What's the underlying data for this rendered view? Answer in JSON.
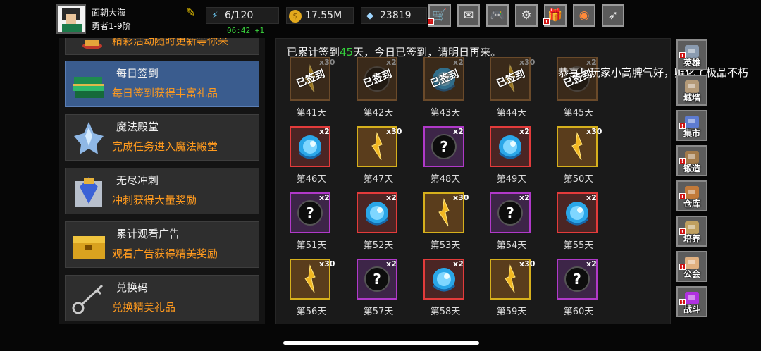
{
  "player": {
    "name": "面朝大海",
    "rank": "勇者1-9阶"
  },
  "resources": {
    "energy": "6/120",
    "timer": "06:42 +1",
    "gold": "17.55M",
    "gems": "23819"
  },
  "toolbar": [
    {
      "name": "shop-cart-icon",
      "badge": "!"
    },
    {
      "name": "mail-icon",
      "badge": ""
    },
    {
      "name": "gamepad-icon",
      "badge": ""
    },
    {
      "name": "gear-icon",
      "badge": ""
    },
    {
      "name": "gift-icon",
      "badge": "!"
    },
    {
      "name": "color-wheel-icon",
      "badge": ""
    },
    {
      "name": "feather-icon",
      "badge": ""
    }
  ],
  "menu": {
    "partial_desc": "精彩活动随时更新等你来",
    "items": [
      {
        "title": "每日签到",
        "desc": "每日签到获得丰富礼品",
        "selected": true
      },
      {
        "title": "魔法殿堂",
        "desc": "完成任务进入魔法殿堂",
        "selected": false
      },
      {
        "title": "无尽冲刺",
        "desc": "冲刺获得大量奖励",
        "selected": false
      },
      {
        "title": "累计观看广告",
        "desc": "观看广告获得精美奖励",
        "selected": false
      },
      {
        "title": "兑换码",
        "desc": "兑换精美礼品",
        "selected": false
      }
    ]
  },
  "checkin": {
    "notice_prefix": "已累计签到",
    "days_count": "45",
    "notice_suffix": "天，今日已签到，请明日再来。",
    "signed_stamp": "已签到",
    "rows": [
      [
        {
          "day": "第41天",
          "qty": "x30",
          "item": "gold-crystal",
          "signed": true
        },
        {
          "day": "第42天",
          "qty": "x2",
          "item": "mystery-orb",
          "signed": true
        },
        {
          "day": "第43天",
          "qty": "x2",
          "item": "blue-orb",
          "signed": true
        },
        {
          "day": "第44天",
          "qty": "x30",
          "item": "gold-crystal",
          "signed": true
        },
        {
          "day": "第45天",
          "qty": "x2",
          "item": "mystery-orb",
          "signed": true
        }
      ],
      [
        {
          "day": "第46天",
          "qty": "x2",
          "item": "blue-orb",
          "signed": false
        },
        {
          "day": "第47天",
          "qty": "x30",
          "item": "gold-crystal",
          "signed": false
        },
        {
          "day": "第48天",
          "qty": "x2",
          "item": "mystery-orb",
          "signed": false
        },
        {
          "day": "第49天",
          "qty": "x2",
          "item": "blue-orb",
          "signed": false
        },
        {
          "day": "第50天",
          "qty": "x30",
          "item": "gold-crystal",
          "signed": false
        }
      ],
      [
        {
          "day": "第51天",
          "qty": "x2",
          "item": "mystery-orb",
          "signed": false
        },
        {
          "day": "第52天",
          "qty": "x2",
          "item": "blue-orb",
          "signed": false
        },
        {
          "day": "第53天",
          "qty": "x30",
          "item": "gold-crystal",
          "signed": false
        },
        {
          "day": "第54天",
          "qty": "x2",
          "item": "mystery-orb",
          "signed": false
        },
        {
          "day": "第55天",
          "qty": "x2",
          "item": "blue-orb",
          "signed": false
        }
      ],
      [
        {
          "day": "第56天",
          "qty": "x30",
          "item": "gold-crystal",
          "signed": false
        },
        {
          "day": "第57天",
          "qty": "x2",
          "item": "mystery-orb",
          "signed": false
        },
        {
          "day": "第58天",
          "qty": "x2",
          "item": "blue-orb",
          "signed": false
        },
        {
          "day": "第59天",
          "qty": "x30",
          "item": "gold-crystal",
          "signed": false
        },
        {
          "day": "第60天",
          "qty": "x2",
          "item": "mystery-orb",
          "signed": false
        }
      ]
    ]
  },
  "ticker": "恭喜！玩家小高脾气好，孵化了极品不朽",
  "sidenav": [
    {
      "label": "英雄",
      "badge": "!"
    },
    {
      "label": "城墙",
      "badge": ""
    },
    {
      "label": "集市",
      "badge": "!"
    },
    {
      "label": "锻造",
      "badge": "!"
    },
    {
      "label": "仓库",
      "badge": "!"
    },
    {
      "label": "培养",
      "badge": "!"
    },
    {
      "label": "公会",
      "badge": "!"
    },
    {
      "label": "战斗",
      "badge": "!"
    }
  ]
}
